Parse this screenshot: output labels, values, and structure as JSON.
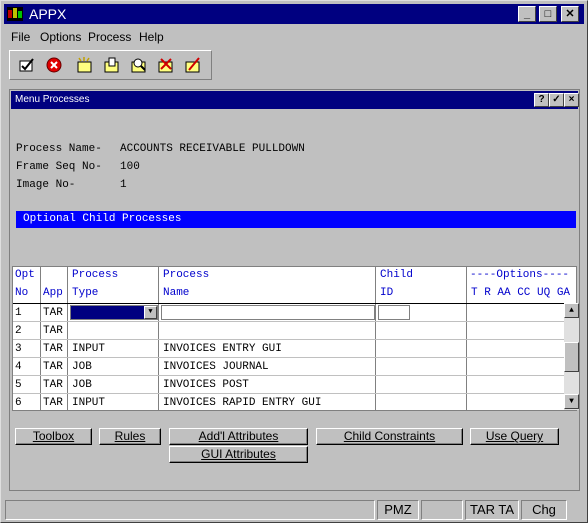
{
  "app": {
    "title": "APPX"
  },
  "menu": {
    "items": [
      "File",
      "Options",
      "Process",
      "Help"
    ]
  },
  "toolbar": {
    "icons": [
      "checkmark-doc-icon",
      "cancel-icon",
      "new-doc-icon",
      "open-doc-icon",
      "search-doc-icon",
      "delete-doc-icon",
      "edit-doc-icon"
    ]
  },
  "child": {
    "title": "Menu Processes",
    "buttons": {
      "help": "?",
      "ok": "✓",
      "close": "×"
    }
  },
  "process": {
    "name_label": "Process Name-",
    "name_value": "ACCOUNTS RECEIVABLE PULLDOWN",
    "frame_label": "Frame Seq No-",
    "frame_value": "100",
    "image_label": "Image No-",
    "image_value": "1"
  },
  "section": {
    "title": "Optional Child Processes"
  },
  "grid": {
    "headers": {
      "opt1": "Opt",
      "opt2": "No",
      "app": "App",
      "ptype1": "Process",
      "ptype2": "Type",
      "pname1": "Process",
      "pname2": "Name",
      "child1": "Child",
      "child2": "ID",
      "opts1": "----Options----",
      "opts2": "T R AA CC UQ GA"
    },
    "rows": [
      {
        "no": "1",
        "app": "TAR",
        "type": "",
        "name": ""
      },
      {
        "no": "2",
        "app": "TAR",
        "type": "",
        "name": ""
      },
      {
        "no": "3",
        "app": "TAR",
        "type": "INPUT",
        "name": "INVOICES ENTRY GUI"
      },
      {
        "no": "4",
        "app": "TAR",
        "type": "JOB",
        "name": "INVOICES JOURNAL"
      },
      {
        "no": "5",
        "app": "TAR",
        "type": "JOB",
        "name": "INVOICES POST"
      },
      {
        "no": "6",
        "app": "TAR",
        "type": "INPUT",
        "name": "INVOICES RAPID ENTRY GUI"
      }
    ]
  },
  "buttons": {
    "toolbox": "Toolbox",
    "rules": "Rules",
    "addl": "Add'l Attributes",
    "child_constraints": "Child Constraints",
    "use_query": "Use Query",
    "gui": "GUI Attributes"
  },
  "status": {
    "p1": "",
    "p2": "PMZ",
    "p3": "",
    "p4": "TAR TA",
    "p5": "Chg"
  }
}
